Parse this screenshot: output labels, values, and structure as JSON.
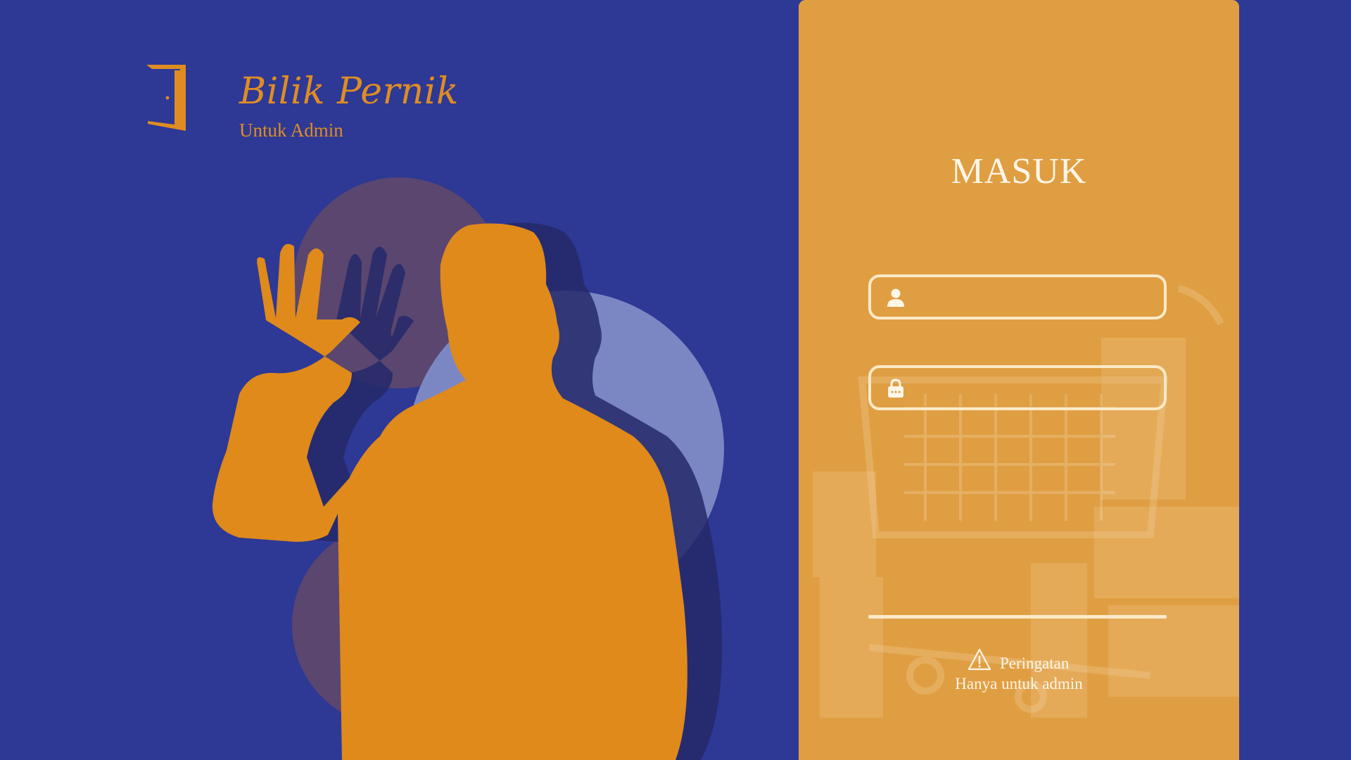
{
  "brand": {
    "title": "Bilik Pernik",
    "subtitle": "Untuk Admin",
    "logo_icon": "door-icon"
  },
  "login": {
    "title": "MASUK",
    "username": {
      "icon": "user-icon",
      "value": "",
      "placeholder": ""
    },
    "password": {
      "icon": "lock-icon",
      "value": "",
      "placeholder": ""
    }
  },
  "warning": {
    "icon": "warning-icon",
    "title": "Peringatan",
    "text": "Hanya untuk admin"
  },
  "colors": {
    "background": "#2e3895",
    "accent": "#df8d22",
    "panel": "#e09e42",
    "field_border": "#fbeac8",
    "text_light": "#fff6e8"
  }
}
